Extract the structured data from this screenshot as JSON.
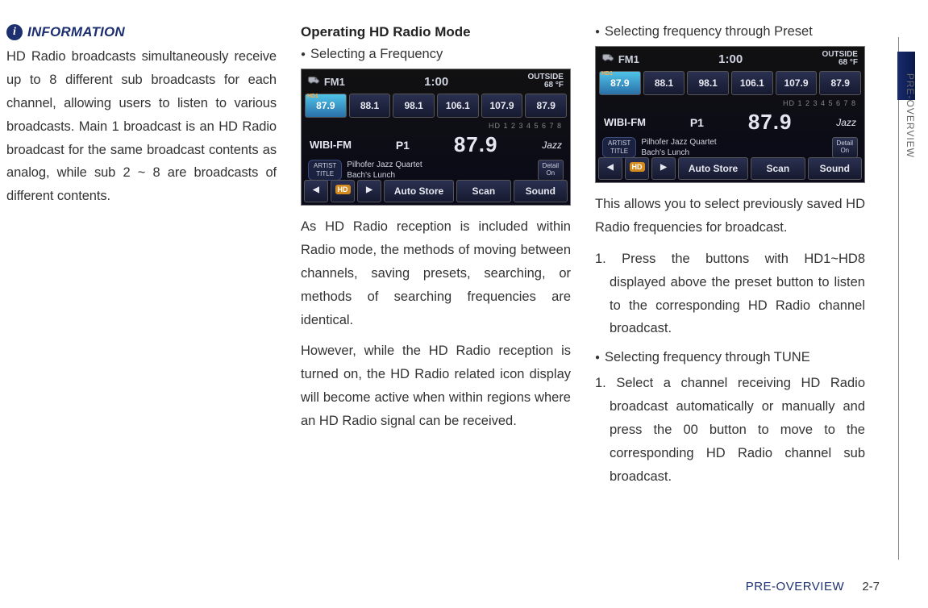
{
  "col1": {
    "info_label": "INFORMATION",
    "info_icon_glyph": "i",
    "info_body": "HD Radio broadcasts simultaneously receive up to 8 different sub broadcasts for each channel, allowing users to listen to various broadcasts. Main 1 broadcast is an HD Radio broadcast for the same broadcast contents as analog, while sub 2 ~ 8 are broadcasts of different contents."
  },
  "col2": {
    "heading": "Operating HD Radio Mode",
    "bullet1": "Selecting a Frequency",
    "para1": "As HD Radio reception is included within Radio mode, the methods of moving between channels, saving presets, searching, or methods of searching frequencies are identical.",
    "para2": "However, while the HD Radio reception is turned on, the HD Radio related icon display will become active when within regions where an HD Radio signal can be received."
  },
  "col3": {
    "bullet1": "Selecting frequency through Preset",
    "para1": "This allows you to select previously saved HD Radio frequencies for broadcast.",
    "step1": "1. Press the buttons with HD1~HD8 displayed above the preset button to listen to the corresponding HD Radio channel broadcast.",
    "bullet2": "Selecting frequency through TUNE",
    "step2": "1. Select a channel receiving HD Radio broadcast automatically or manually and press the 00 button to move to the corresponding HD Radio channel sub broadcast."
  },
  "radio": {
    "band": "FM1",
    "time": "1:00",
    "temp_label": "OUTSIDE",
    "temp_val": "68 °F",
    "presets": [
      "87.9",
      "88.1",
      "98.1",
      "106.1",
      "107.9",
      "87.9"
    ],
    "active_preset_hd": "HD1",
    "hd_row": "HD 1 2 3 4 5 6 7 8",
    "station": "WIBI-FM",
    "preset_num": "P1",
    "freq": "87.9",
    "genre": "Jazz",
    "at_label": "ARTIST\nTITLE",
    "track_line1": "Pilhofer Jazz Quartet",
    "track_line2": "Bach's Lunch",
    "detail": "Detail\nOn",
    "hd_badge": "HD",
    "btn_auto": "Auto Store",
    "btn_scan": "Scan",
    "btn_sound": "Sound"
  },
  "side": {
    "label": "PRE-OVERVIEW"
  },
  "footer": {
    "section": "PRE-OVERVIEW",
    "page": "2-7"
  }
}
